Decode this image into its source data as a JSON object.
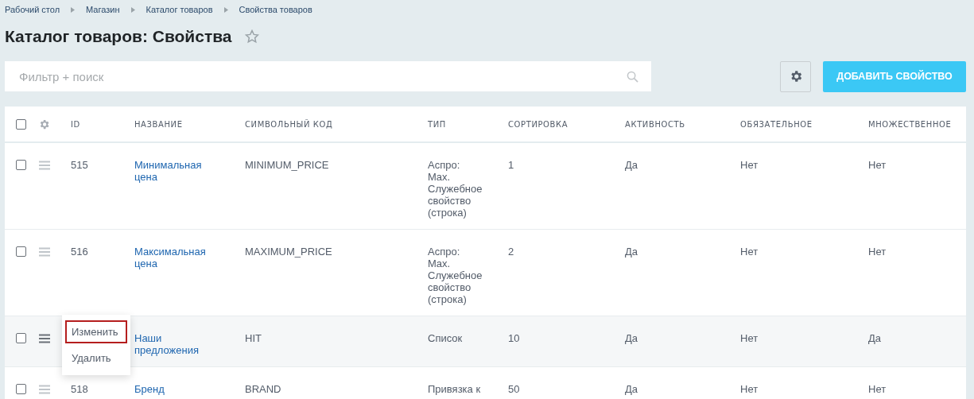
{
  "breadcrumbs": [
    "Рабочий стол",
    "Магазин",
    "Каталог товаров",
    "Свойства товаров"
  ],
  "title": "Каталог товаров: Свойства",
  "favorite": false,
  "search": {
    "placeholder": "Фильтр + поиск"
  },
  "add_button": "ДОБАВИТЬ СВОЙСТВО",
  "table": {
    "all_checked": false,
    "columns": [
      "ID",
      "НАЗВАНИЕ",
      "СИМВОЛЬНЫЙ КОД",
      "ТИП",
      "СОРТИРОВКА",
      "АКТИВНОСТЬ",
      "ОБЯЗАТЕЛЬНОЕ",
      "МНОЖЕСТВЕННОЕ"
    ],
    "rows": [
      {
        "checked": false,
        "hovered": false,
        "cells": [
          "515",
          "Минимальная цена",
          "MINIMUM_PRICE",
          "Аспро: Max. Служебное свойство (строка)",
          "1",
          "Да",
          "Нет",
          "Нет"
        ]
      },
      {
        "checked": false,
        "hovered": false,
        "cells": [
          "516",
          "Максимальная цена",
          "MAXIMUM_PRICE",
          "Аспро: Max. Служебное свойство (строка)",
          "2",
          "Да",
          "Нет",
          "Нет"
        ]
      },
      {
        "checked": false,
        "hovered": true,
        "menu": [
          {
            "label": "Изменить",
            "focused": true
          },
          {
            "label": "Удалить",
            "focused": false
          }
        ],
        "cells": [
          "",
          "Наши предложения",
          "HIT",
          "Список",
          "10",
          "Да",
          "Нет",
          "Да"
        ]
      },
      {
        "checked": false,
        "hovered": false,
        "cells": [
          "518",
          "Бренд",
          "BRAND",
          "Привязка к",
          "50",
          "Да",
          "Нет",
          "Нет"
        ]
      }
    ]
  }
}
